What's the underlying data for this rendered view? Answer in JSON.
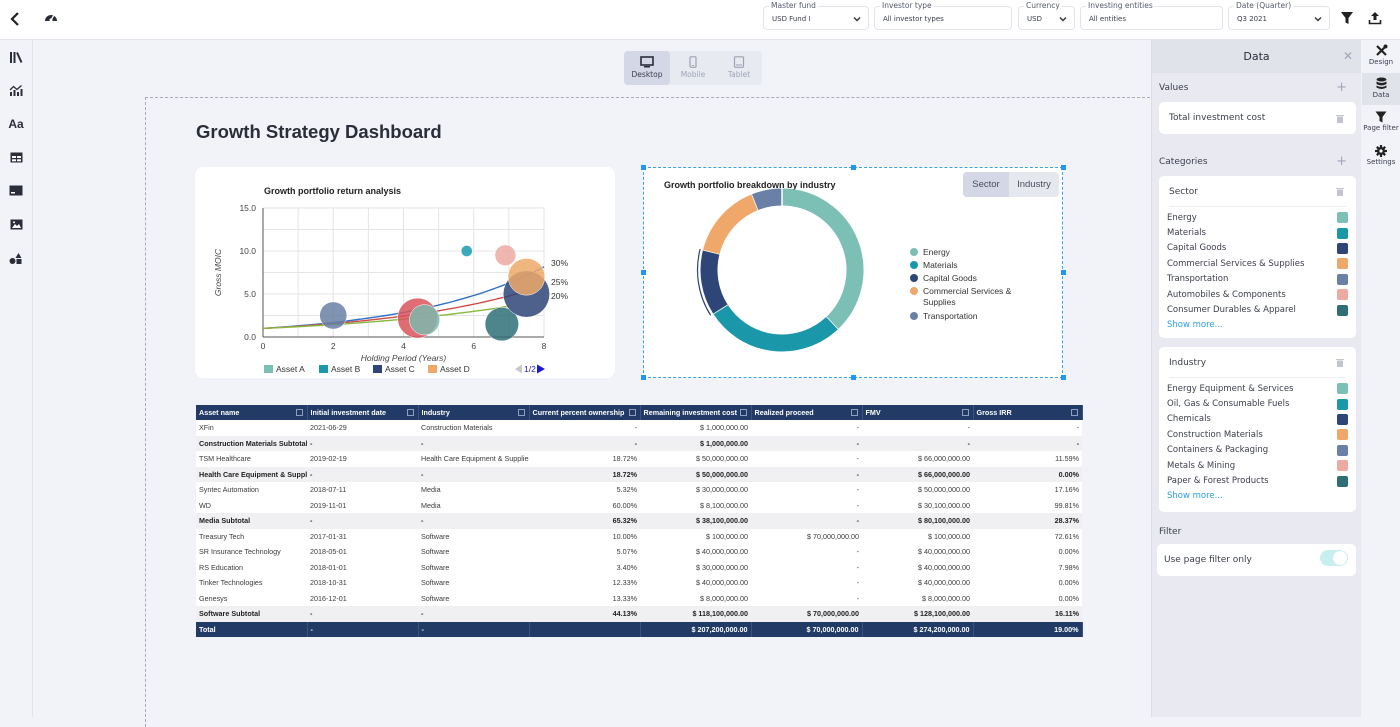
{
  "topbar": {
    "filters": [
      {
        "label": "Master fund",
        "value": "USD Fund I",
        "has_dropdown": true
      },
      {
        "label": "Investor type",
        "value": "All investor types",
        "has_dropdown": false
      },
      {
        "label": "Currency",
        "value": "USD",
        "has_dropdown": true
      },
      {
        "label": "Investing entities",
        "value": "All entities",
        "has_dropdown": false
      },
      {
        "label": "Date (Quarter)",
        "value": "Q3 2021",
        "has_dropdown": true
      }
    ],
    "icons": [
      "back-icon",
      "dashboard-gauge-icon",
      "filter-icon",
      "export-upload-icon"
    ]
  },
  "leftbar": {
    "items": [
      "library-icon",
      "chart-icon",
      "text-icon",
      "table-icon",
      "card-icon",
      "image-icon",
      "shapes-icon"
    ]
  },
  "device_switch": {
    "options": [
      {
        "label": "Desktop",
        "active": true
      },
      {
        "label": "Mobile",
        "active": false
      },
      {
        "label": "Tablet",
        "active": false
      }
    ]
  },
  "page": {
    "title": "Growth Strategy Dashboard"
  },
  "chart_data": [
    {
      "type": "scatter",
      "subtype": "bubble",
      "title": "Growth portfolio return analysis",
      "xlabel": "Holding Period (Years)",
      "ylabel": "Gross MOIC",
      "xlim": [
        0,
        8
      ],
      "ylim": [
        0,
        15
      ],
      "xticks": [
        "0",
        "2",
        "4",
        "6",
        "8"
      ],
      "yticks": [
        "0.0",
        "5.0",
        "10.0",
        "15.0"
      ],
      "grid": true,
      "legend": {
        "position": "bottom",
        "entries": [
          "Asset A",
          "Asset B",
          "Asset C",
          "Asset D"
        ],
        "page": "1/2"
      },
      "bubbles": [
        {
          "x": 2.0,
          "y": 2.5,
          "size": 3,
          "color": "#6a80a6"
        },
        {
          "x": 4.4,
          "y": 2.2,
          "size": 5,
          "color": "#d9545c"
        },
        {
          "x": 4.6,
          "y": 2.0,
          "size": 3.5,
          "color": "#7fb8ad"
        },
        {
          "x": 5.8,
          "y": 10.0,
          "size": 0.5,
          "color": "#1a9bb0"
        },
        {
          "x": 6.8,
          "y": 1.5,
          "size": 4,
          "color": "#2f6e78"
        },
        {
          "x": 6.9,
          "y": 9.5,
          "size": 2,
          "color": "#ecaaa2"
        },
        {
          "x": 7.5,
          "y": 5.0,
          "size": 6,
          "color": "#2e4578"
        },
        {
          "x": 7.5,
          "y": 7.0,
          "size": 4.5,
          "color": "#efa86a"
        }
      ],
      "curves": [
        {
          "label": "30%",
          "rate": 0.3,
          "color": "#2f6fc4"
        },
        {
          "label": "25%",
          "rate": 0.25,
          "color": "#d04a4a"
        },
        {
          "label": "20%",
          "rate": 0.2,
          "color": "#88b83a"
        }
      ]
    },
    {
      "type": "pie",
      "subtype": "donut",
      "title": "Growth portfolio breakdown by industry",
      "legend": {
        "position": "right"
      },
      "slices": [
        {
          "label": "Energy",
          "value": 38,
          "color": "#7cc0b5"
        },
        {
          "label": "Materials",
          "value": 28,
          "color": "#1a98aa"
        },
        {
          "label": "Capital Goods",
          "value": 13,
          "color": "#2e4578"
        },
        {
          "label": "Commercial Services & Supplies",
          "value": 15,
          "color": "#efa86a"
        },
        {
          "label": "Transportation",
          "value": 6,
          "color": "#6a80a6"
        }
      ]
    }
  ],
  "donut_toggle": {
    "options": [
      {
        "label": "Sector",
        "active": true
      },
      {
        "label": "Industry",
        "active": false
      }
    ]
  },
  "table": {
    "columns": [
      "Asset name",
      "Initial investment date",
      "Industry",
      "Current percent ownership",
      "Remaining investment cost",
      "Realized proceed",
      "FMV",
      "Gross IRR"
    ],
    "rows": [
      {
        "type": "row",
        "cells": [
          "XFin",
          "2021-06-29",
          "Construction Materials",
          "-",
          "$ 1,000,000.00",
          "-",
          "-",
          "-"
        ]
      },
      {
        "type": "sub",
        "cells": [
          "Construction Materials Subtotal",
          "-",
          "-",
          "-",
          "$ 1,000,000.00",
          "-",
          "-",
          "-"
        ]
      },
      {
        "type": "row",
        "cells": [
          "TSM Healthcare",
          "2019-02-19",
          "Health Care Equipment & Supplies",
          "18.72%",
          "$ 50,000,000.00",
          "-",
          "$ 66,000,000.00",
          "11.59%"
        ]
      },
      {
        "type": "sub",
        "cells": [
          "Health Care Equipment & Supplies Subtotal",
          "-",
          "-",
          "18.72%",
          "$ 50,000,000.00",
          "-",
          "$ 66,000,000.00",
          "0.00%"
        ]
      },
      {
        "type": "row",
        "cells": [
          "Syntec Automation",
          "2018-07-11",
          "Media",
          "5.32%",
          "$ 30,000,000.00",
          "-",
          "$ 50,000,000.00",
          "17.16%"
        ]
      },
      {
        "type": "row",
        "cells": [
          "WD",
          "2019-11-01",
          "Media",
          "60.00%",
          "$ 8,100,000.00",
          "-",
          "$ 30,100,000.00",
          "99.81%"
        ]
      },
      {
        "type": "sub",
        "cells": [
          "Media Subtotal",
          "-",
          "-",
          "65.32%",
          "$ 38,100,000.00",
          "-",
          "$ 80,100,000.00",
          "28.37%"
        ]
      },
      {
        "type": "row",
        "cells": [
          "Treasury Tech",
          "2017-01-31",
          "Software",
          "10.00%",
          "$ 100,000.00",
          "$ 70,000,000.00",
          "$ 100,000.00",
          "72.61%"
        ]
      },
      {
        "type": "row",
        "cells": [
          "SR Insurance Technology",
          "2018-05-01",
          "Software",
          "5.07%",
          "$ 40,000,000.00",
          "-",
          "$ 40,000,000.00",
          "0.00%"
        ]
      },
      {
        "type": "row",
        "cells": [
          "RS Education",
          "2018-01-01",
          "Software",
          "3.40%",
          "$ 30,000,000.00",
          "-",
          "$ 40,000,000.00",
          "7.98%"
        ]
      },
      {
        "type": "row",
        "cells": [
          "Tinker Technologies",
          "2018-10-31",
          "Software",
          "12.33%",
          "$ 40,000,000.00",
          "-",
          "$ 40,000,000.00",
          "0.00%"
        ]
      },
      {
        "type": "row",
        "cells": [
          "Genesys",
          "2016-12-01",
          "Software",
          "13.33%",
          "$ 8,000,000.00",
          "-",
          "$ 8,000,000.00",
          "0.00%"
        ]
      },
      {
        "type": "sub",
        "cells": [
          "Software Subtotal",
          "-",
          "-",
          "44.13%",
          "$ 118,100,000.00",
          "$ 70,000,000.00",
          "$ 128,100,000.00",
          "16.11%"
        ]
      },
      {
        "type": "total",
        "cells": [
          "Total",
          "-",
          "-",
          "",
          "$ 207,200,000.00",
          "$ 70,000,000.00",
          "$ 274,200,000.00",
          "19.00%"
        ]
      }
    ]
  },
  "right_panel": {
    "title": "Data",
    "values_label": "Values",
    "values_item": "Total investment cost",
    "categories_label": "Categories",
    "sector": {
      "title": "Sector",
      "items": [
        {
          "label": "Energy",
          "color": "#7cc0b5"
        },
        {
          "label": "Materials",
          "color": "#1a98aa"
        },
        {
          "label": "Capital Goods",
          "color": "#2e4578"
        },
        {
          "label": "Commercial Services & Supplies",
          "color": "#efa86a"
        },
        {
          "label": "Transportation",
          "color": "#6a80a6"
        },
        {
          "label": "Automobiles & Components",
          "color": "#ecaaa2"
        },
        {
          "label": "Consumer Durables & Apparel",
          "color": "#2f6e78"
        }
      ],
      "show_more": "Show more..."
    },
    "industry": {
      "title": "Industry",
      "items": [
        {
          "label": "Energy Equipment & Services",
          "color": "#7cc0b5"
        },
        {
          "label": "Oil, Gas & Consumable Fuels",
          "color": "#1a98aa"
        },
        {
          "label": "Chemicals",
          "color": "#2e4578"
        },
        {
          "label": "Construction Materials",
          "color": "#efa86a"
        },
        {
          "label": "Containers & Packaging",
          "color": "#6a80a6"
        },
        {
          "label": "Metals & Mining",
          "color": "#ecaaa2"
        },
        {
          "label": "Paper & Forest Products",
          "color": "#2f6e78"
        }
      ],
      "show_more": "Show more..."
    },
    "filter_label": "Filter",
    "filter_option": "Use page filter only",
    "filter_toggle_on": true
  },
  "right_tabs": [
    {
      "label": "Design",
      "icon": "design-tools-icon",
      "active": false
    },
    {
      "label": "Data",
      "icon": "database-icon",
      "active": true
    },
    {
      "label": "Page filter",
      "icon": "funnel-icon",
      "active": false
    },
    {
      "label": "Settings",
      "icon": "gear-icon",
      "active": false
    }
  ]
}
